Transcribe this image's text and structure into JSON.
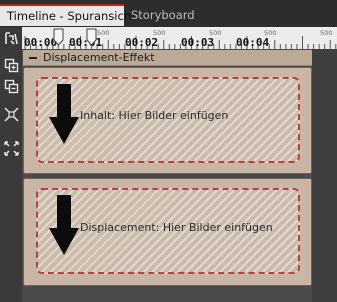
{
  "tabs": [
    {
      "label": "Timeline - Spuransicht",
      "active": true
    },
    {
      "label": "Storyboard",
      "active": false
    }
  ],
  "toolbar": {
    "icons": [
      "timeline-tool-icon",
      "group-icon",
      "ungroup-icon",
      "fit-selection-icon",
      "fit-all-icon"
    ]
  },
  "ruler": {
    "major_labels": [
      "00:00",
      "00:01",
      "00:02",
      "00:03",
      "00:04"
    ],
    "minor_label": "500"
  },
  "section": {
    "title": "Displacement-Effekt",
    "collapse_symbol": "−"
  },
  "tracks": [
    {
      "label": "Inhalt: Hier Bilder einfügen"
    },
    {
      "label": "Displacement: Hier Bilder einfügen"
    }
  ],
  "colors": {
    "active_tab_accent": "#b5261e",
    "track_bg": "#c9b6a4",
    "dropzone_border": "#b7404a"
  }
}
